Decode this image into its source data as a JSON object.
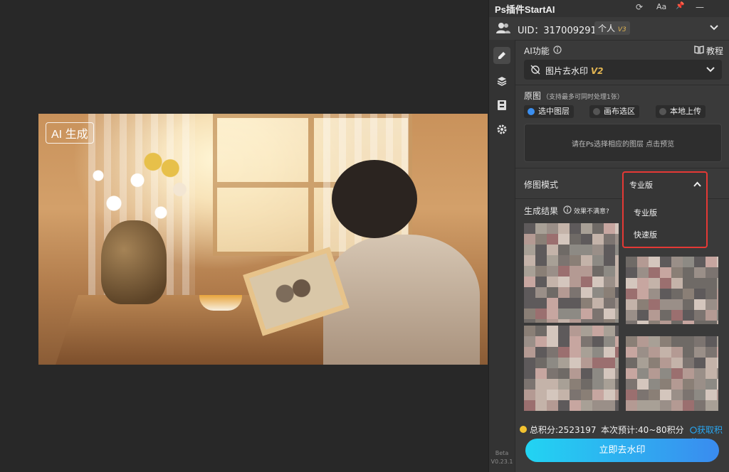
{
  "canvas": {
    "badge": "AI 生成"
  },
  "panel": {
    "title": "Ps插件StartAI",
    "title_icons": [
      "refresh-icon",
      "font-size-icon",
      "pin-icon",
      "minimize-icon"
    ],
    "title_icon_glyphs": [
      "⟳",
      "Aa",
      "📌",
      "—"
    ],
    "user": {
      "uid": "UID：317009291",
      "level_label": "个人",
      "level_badge": "V3"
    },
    "ai_function": {
      "label": "AI功能",
      "tutorial": "教程",
      "selected": "图片去水印",
      "version": "V2"
    },
    "source": {
      "label": "原图",
      "hint": "（支持最多可同时处理1张）",
      "options": [
        "选中图层",
        "画布选区",
        "本地上传"
      ],
      "selected_index": 0,
      "drop_text": "请在Ps选择相应的图层 点击预览"
    },
    "mode": {
      "label": "修图模式",
      "selected": "专业版",
      "options": [
        "专业版",
        "快速版"
      ]
    },
    "results": {
      "label": "生成结果",
      "feedback": "效果不满意?"
    },
    "footer": {
      "points": "总积分:2523197",
      "estimate": "本次预计:40~80积分",
      "get_points": "获取积分",
      "cta": "立即去水印"
    },
    "version": {
      "label": "Beta",
      "number": "V0.23.1"
    }
  },
  "colors": {
    "accent": "#29a7f2",
    "highlight": "#e53935",
    "gold": "#e2b552",
    "panel_bg": "#3a3a3a",
    "app_bg": "#282828"
  }
}
